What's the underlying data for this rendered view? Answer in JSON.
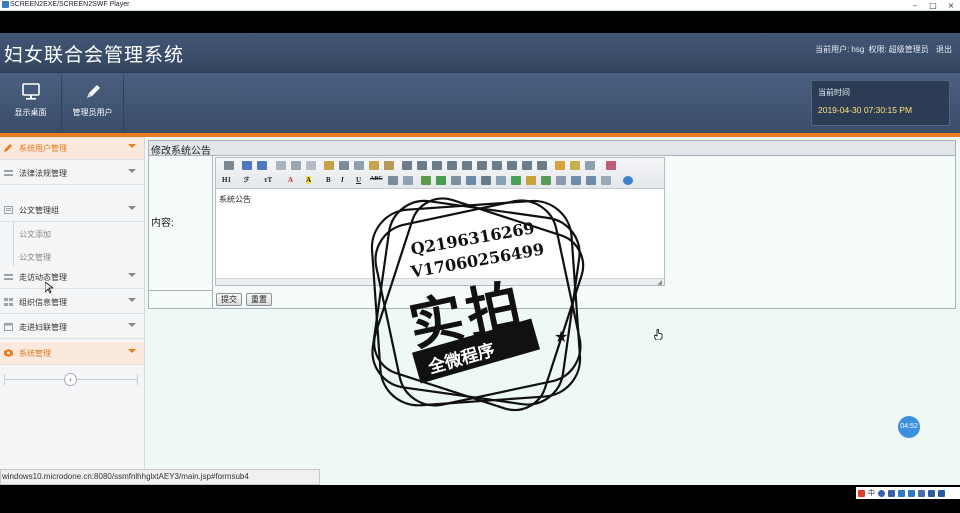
{
  "player": {
    "title": "SCREEN2EXE/SCREEN2SWF Player",
    "controls": [
      "–",
      "□",
      "×"
    ]
  },
  "app": {
    "title": "妇女联合会管理系统",
    "user_info": {
      "current_user_label": "当前用户:",
      "username": "hsg",
      "role_label": "权限:",
      "role": "超级管理员",
      "logout": "退出"
    },
    "nav": [
      {
        "label": "显示桌面",
        "icon": "monitor-icon"
      },
      {
        "label": "管理员用户",
        "icon": "pencil-icon"
      }
    ],
    "time": {
      "label": "当前时间",
      "value": "2019-04-30 07:30:15 PM"
    }
  },
  "sidebar": {
    "items": [
      {
        "label": "系统用户管理",
        "icon": "pencil-icon"
      },
      {
        "label": "法律法规管理",
        "icon": "grid-icon"
      },
      {
        "label": "公文管理组",
        "icon": "document-icon"
      },
      {
        "label": "走访动态管理",
        "icon": "grid-icon"
      },
      {
        "label": "组织信息管理",
        "icon": "grid-icon"
      },
      {
        "label": "走进妇联管理",
        "icon": "document-icon"
      },
      {
        "label": "系统管理",
        "icon": "gear-icon"
      }
    ],
    "sub_items": [
      "公文添加",
      "公文管理"
    ],
    "collapse": "‹"
  },
  "main": {
    "panel_title": "修改系统公告",
    "content_label": "内容:",
    "toolbar_text": {
      "h1": "H1",
      "font_family": "ℱ",
      "font_size": "тT",
      "font_color": "A",
      "highlight": "A",
      "bold": "B",
      "italic": "I",
      "underline": "U",
      "strike": "ABC"
    },
    "editor_content": "系统公告",
    "buttons": {
      "submit": "提交",
      "reset": "重置"
    }
  },
  "watermark": {
    "qq": "Q2196316269",
    "vx": "V17060256499",
    "big": "实拍",
    "banner": "全微程序"
  },
  "status_url": "windows10.microdone.cn:8080/ssmfnlhhglxtAEY3/main.jsp#formsub4",
  "timer": "04:52",
  "tray": {
    "lang": "中"
  },
  "colors": {
    "accent": "#e77d22",
    "header": "#3c4e6a",
    "time_value": "#ffe27a"
  }
}
